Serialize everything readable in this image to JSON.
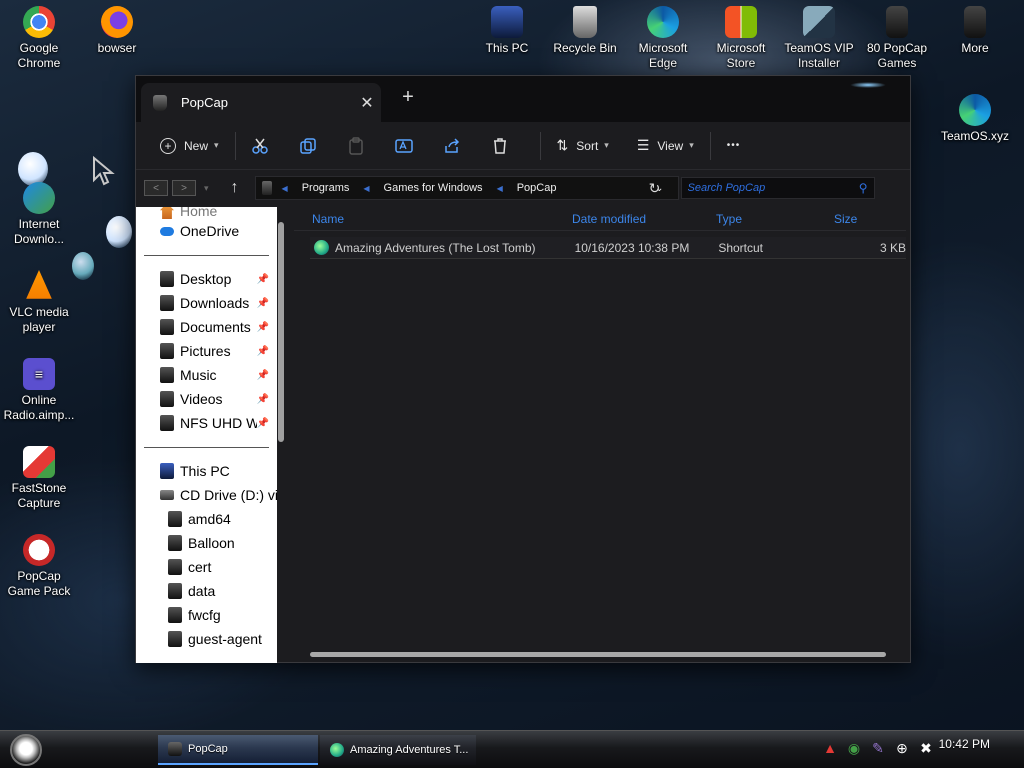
{
  "desktop": {
    "left_icons": [
      {
        "label": "Google Chrome",
        "icon": "chrome-icon"
      },
      {
        "label": "Internet Downlo...",
        "icon": "idm-icon"
      },
      {
        "label": "VLC media player",
        "icon": "vlc-icon"
      },
      {
        "label": "Online Radio.aimp...",
        "icon": "aimp-icon"
      },
      {
        "label": "FastStone Capture",
        "icon": "faststone-icon"
      },
      {
        "label": "PopCap Game Pack",
        "icon": "popcap-icon"
      }
    ],
    "second_col_icons": [
      {
        "label": "bowser",
        "icon": "firefox-icon"
      }
    ],
    "top_icons": [
      {
        "label": "This PC",
        "icon": "this-pc-icon"
      },
      {
        "label": "Recycle Bin",
        "icon": "recycle-bin-icon"
      },
      {
        "label": "Microsoft Edge",
        "icon": "edge-icon"
      },
      {
        "label": "Microsoft Store",
        "icon": "store-icon"
      },
      {
        "label": "TeamOS VIP Installer",
        "icon": "teamos-installer-icon"
      },
      {
        "label": "80 PopCap Games",
        "icon": "folder-icon"
      },
      {
        "label": "More",
        "icon": "folder-icon"
      }
    ],
    "right_icons": [
      {
        "label": "TeamOS.xyz",
        "icon": "edge-icon"
      }
    ]
  },
  "window": {
    "tab_title": "PopCap",
    "toolbar": {
      "new_label": "New",
      "sort_label": "Sort",
      "view_label": "View",
      "more_label": "•••"
    },
    "breadcrumb": [
      "Programs",
      "Games for Windows",
      "PopCap"
    ],
    "search_placeholder": "Search PopCap",
    "nav": {
      "quick": [
        {
          "label": "Home"
        },
        {
          "label": "OneDrive"
        }
      ],
      "pinned": [
        {
          "label": "Desktop"
        },
        {
          "label": "Downloads"
        },
        {
          "label": "Documents"
        },
        {
          "label": "Pictures"
        },
        {
          "label": "Music"
        },
        {
          "label": "Videos"
        },
        {
          "label": "NFS UHD Wa"
        }
      ],
      "pc": [
        {
          "label": "This PC"
        },
        {
          "label": "CD Drive (D:) virt"
        },
        {
          "label": "amd64"
        },
        {
          "label": "Balloon"
        },
        {
          "label": "cert"
        },
        {
          "label": "data"
        },
        {
          "label": "fwcfg"
        },
        {
          "label": "guest-agent"
        }
      ]
    },
    "columns": {
      "name": "Name",
      "date": "Date modified",
      "type": "Type",
      "size": "Size"
    },
    "files": [
      {
        "name": "Amazing Adventures (The Lost Tomb)",
        "date": "10/16/2023 10:38 PM",
        "type": "Shortcut",
        "size": "3 KB"
      }
    ]
  },
  "taskbar": {
    "tasks": [
      {
        "label": "PopCap"
      },
      {
        "label": "Amazing Adventures T..."
      }
    ],
    "clock": "10:42 PM"
  },
  "colors": {
    "accent": "#3c86ea",
    "window_bg": "#1c1c1f",
    "nav_bg": "#ffffff"
  }
}
